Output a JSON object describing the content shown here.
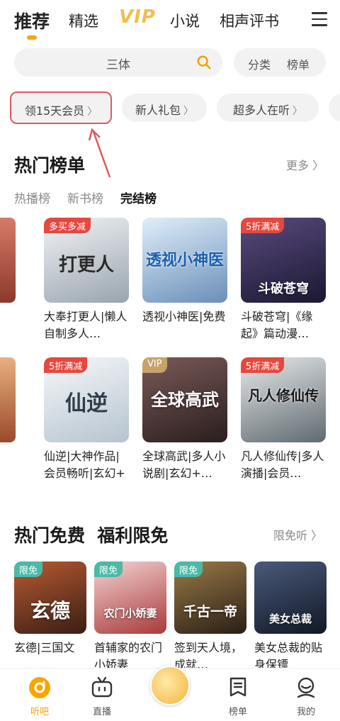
{
  "top_tabs": [
    {
      "label": "推荐"
    },
    {
      "label": "精选"
    },
    {
      "label": "VIP"
    },
    {
      "label": "小说"
    },
    {
      "label": "相声评书"
    }
  ],
  "search": {
    "placeholder": "三体"
  },
  "sort": {
    "category": "分类",
    "ranking": "榜单"
  },
  "chips": [
    {
      "label": "领15天会员"
    },
    {
      "label": "新人礼包"
    },
    {
      "label": "超多人在听"
    }
  ],
  "hot_ranking": {
    "title": "热门榜单",
    "more": "更多",
    "subtabs": [
      "热播榜",
      "新书榜",
      "完结榜"
    ],
    "books": [
      {
        "title": "大奉打更人|懒人自制多人…",
        "badge": "多买多减",
        "cover_text": "打更人",
        "color1": "#e9eef2",
        "color2": "#8e9aa4"
      },
      {
        "title": "透视小神医|免费",
        "badge": "",
        "cover_text": "透视小神医",
        "color1": "#cfe4f7",
        "color2": "#5a7fa8"
      },
      {
        "title": "斗破苍穹|《缘起》篇动漫…",
        "badge": "5折满减",
        "cover_text": "斗破苍穹",
        "color1": "#4a3d6e",
        "color2": "#1c1a2e"
      },
      {
        "title": "仙逆|大神作品|会员畅听|玄幻+",
        "badge": "5折满减",
        "cover_text": "仙逆",
        "color1": "#f3f5f7",
        "color2": "#b9c6d2"
      },
      {
        "title": "全球高武|多人小说剧|玄幻+…",
        "badge": "VIP",
        "cover_text": "全球高武",
        "color1": "#6b4a49",
        "color2": "#2a1e1e"
      },
      {
        "title": "凡人修仙传|多人演播|会员…",
        "badge": "5折满减",
        "cover_text": "凡人修仙传",
        "color1": "#d9dde0",
        "color2": "#6f7a80"
      }
    ]
  },
  "free_section": {
    "title": "热门免费  福利限免",
    "more": "限免听",
    "books": [
      {
        "title": "玄德|三国文",
        "badge": "限免",
        "cover_text": "玄德",
        "color1": "#a84d2a",
        "color2": "#3a1e14"
      },
      {
        "title": "首辅家的农门小娇妻",
        "badge": "限免",
        "cover_text": "农门小娇妻",
        "color1": "#f0c8c8",
        "color2": "#a33a3a"
      },
      {
        "title": "签到天人境，成就…",
        "badge": "限免",
        "cover_text": "千古一帝",
        "color1": "#8a6a3a",
        "color2": "#2a1f15"
      },
      {
        "title": "美女总裁的贴身保镖",
        "badge": "",
        "cover_text": "美女总裁",
        "color1": "#3a4a6a",
        "color2": "#121826"
      }
    ]
  },
  "bottom_nav": [
    {
      "label": "听吧"
    },
    {
      "label": "直播"
    },
    {
      "label": ""
    },
    {
      "label": "榜单"
    },
    {
      "label": "我的"
    }
  ],
  "colors": {
    "accent": "#f7a600",
    "highlight_border": "#e0585f",
    "badge_red": "#e5483f"
  }
}
